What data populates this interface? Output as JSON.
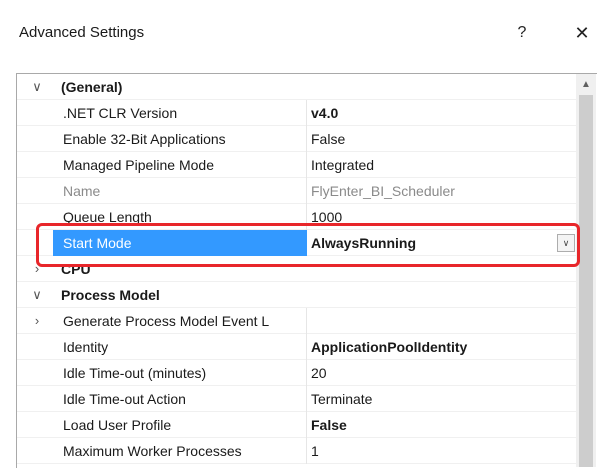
{
  "dialog": {
    "title": "Advanced Settings",
    "help_label": "?",
    "close_label": "✕"
  },
  "grid": {
    "rows": [
      {
        "type": "category",
        "expanded": true,
        "label": "(General)",
        "toggle": "∨"
      },
      {
        "type": "property",
        "name": ".NET CLR Version",
        "value": "v4.0",
        "bold": true
      },
      {
        "type": "property",
        "name": "Enable 32-Bit Applications",
        "value": "False"
      },
      {
        "type": "property",
        "name": "Managed Pipeline Mode",
        "value": "Integrated"
      },
      {
        "type": "property",
        "name": "Name",
        "value": "FlyEnter_BI_Scheduler",
        "disabled": true
      },
      {
        "type": "property",
        "name": "Queue Length",
        "value": "1000"
      },
      {
        "type": "property",
        "name": "Start Mode",
        "value": "AlwaysRunning",
        "bold": true,
        "selected": true,
        "dropdown": "∨"
      },
      {
        "type": "category",
        "expanded": false,
        "label": "CPU",
        "toggle": "›"
      },
      {
        "type": "category",
        "expanded": true,
        "label": "Process Model",
        "toggle": "∨"
      },
      {
        "type": "property",
        "name": "Generate Process Model Event L",
        "value": "",
        "toggle": "›"
      },
      {
        "type": "property",
        "name": "Identity",
        "value": "ApplicationPoolIdentity",
        "bold": true
      },
      {
        "type": "property",
        "name": "Idle Time-out (minutes)",
        "value": "20"
      },
      {
        "type": "property",
        "name": "Idle Time-out Action",
        "value": "Terminate"
      },
      {
        "type": "property",
        "name": "Load User Profile",
        "value": "False",
        "bold": true
      },
      {
        "type": "property",
        "name": "Maximum Worker Processes",
        "value": "1"
      }
    ]
  },
  "scrollbar": {
    "up_arrow": "▲"
  },
  "colors": {
    "selection": "#3399ff",
    "annotation": "#e8262a"
  }
}
